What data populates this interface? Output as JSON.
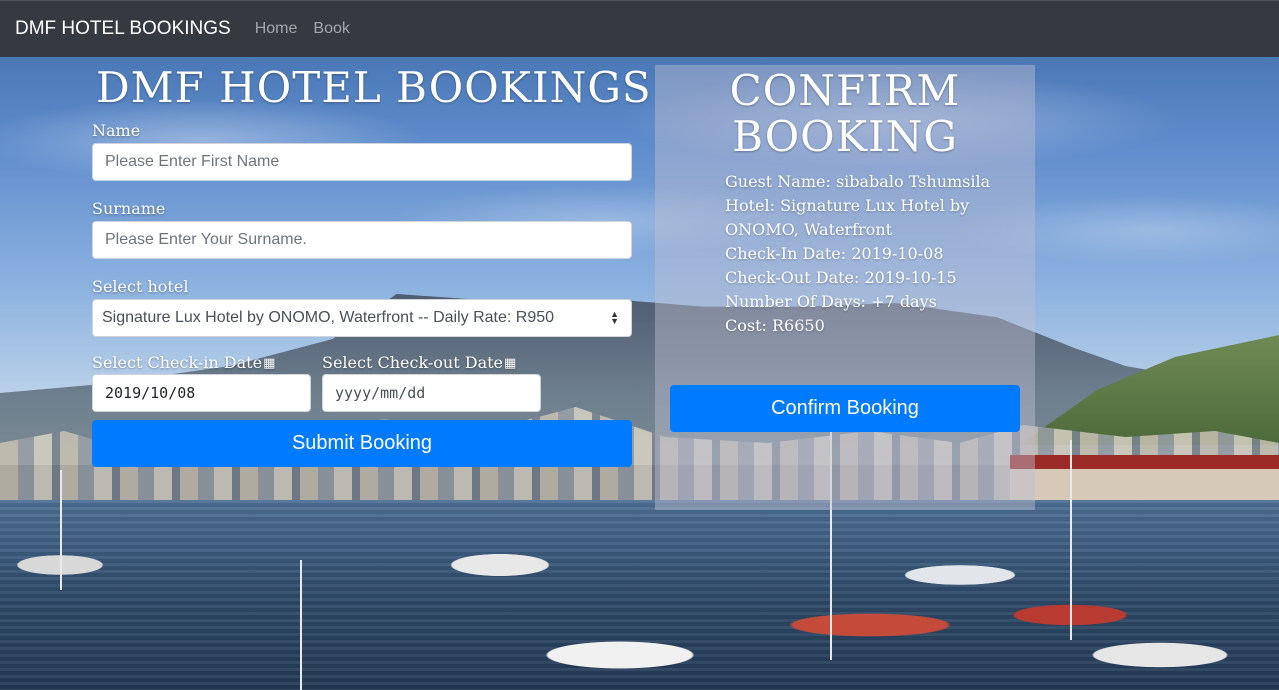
{
  "navbar": {
    "brand": "DMF HOTEL BOOKINGS",
    "links": [
      "Home",
      "Book"
    ]
  },
  "form": {
    "title": "DMF HOTEL BOOKINGS",
    "name_label": "Name",
    "name_placeholder": "Please Enter First Name",
    "surname_label": "Surname",
    "surname_placeholder": "Please Enter Your Surname.",
    "hotel_label": "Select hotel",
    "hotel_selected": "Signature Lux Hotel by ONOMO, Waterfront -- Daily Rate: R950",
    "checkin_label": "Select Check-in Date",
    "checkout_label": "Select Check-out Date",
    "checkin_value": "2019/10/08",
    "checkout_placeholder": "yyyy/mm/dd",
    "submit_label": "Submit Booking"
  },
  "confirm": {
    "title_line1": "CONFIRM",
    "title_line2": "BOOKING",
    "guest_name": "Guest Name: sibabalo Tshumsila",
    "hotel": "Hotel: Signature Lux Hotel by ONOMO, Waterfront",
    "check_in": "Check-In Date: 2019-10-08",
    "check_out": "Check-Out Date: 2019-10-15",
    "days": "Number Of Days: +7 days",
    "cost": "Cost: R6650",
    "button_label": "Confirm Booking"
  },
  "icons": {
    "calendar": "calendar-icon",
    "select_arrows": "select-arrows-icon"
  },
  "colors": {
    "navbar_bg": "#343a40",
    "primary_button": "#007bff",
    "panel_overlay": "rgba(190,190,210,0.45)"
  }
}
